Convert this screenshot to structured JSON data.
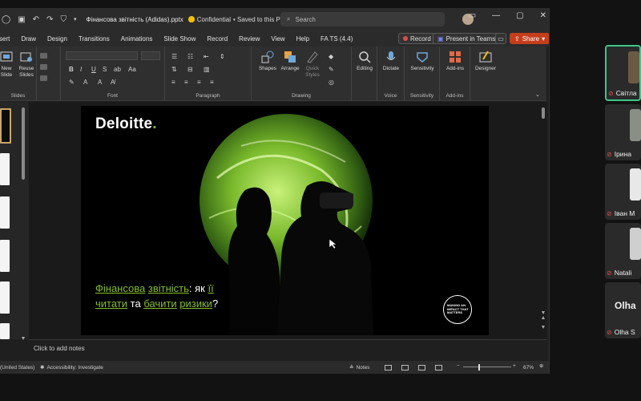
{
  "window": {
    "doc_title": "Фінансова звітність (Adidas).pptx",
    "confidential": "Confidential",
    "saved": "• Saved to this PC",
    "search_placeholder": "Search"
  },
  "tabs": [
    "sert",
    "Draw",
    "Design",
    "Transitions",
    "Animations",
    "Slide Show",
    "Record",
    "Review",
    "View",
    "Help",
    "FA TS (4.4)"
  ],
  "pills": {
    "record": "Record",
    "teams": "Present in Teams",
    "share": "Share"
  },
  "ribbon": {
    "new_slide": "New Slide",
    "reuse_slides": "Reuse Slides",
    "slides_label": "Slides",
    "font_label": "Font",
    "paragraph_label": "Paragraph",
    "shapes": "Shapes",
    "arrange": "Arrange",
    "quick_styles": "Quick Styles",
    "drawing_label": "Drawing",
    "editing": "Editing",
    "dictate": "Dictate",
    "voice_label": "Voice",
    "sensitivity": "Sensitivity",
    "sensitivity_label": "Sensitivity",
    "addins": "Add-ins",
    "addins_label": "Add-ins",
    "designer": "Designer"
  },
  "slide": {
    "logo": "Deloitte",
    "logo_dot": ".",
    "title_line1_a": "Фінансова",
    "title_line1_b": "звітність",
    "title_line1_c": ": як",
    "title_line1_d": "її",
    "title_line2_a": "читати",
    "title_line2_b": "та",
    "title_line2_c": "бачити",
    "title_line2_d": "ризики",
    "title_line2_e": "?",
    "badge": [
      "MAKING AN",
      "IMPACT THAT",
      "MATTERS"
    ]
  },
  "notes_placeholder": "Click to add notes",
  "status": {
    "language": "(United States)",
    "accessibility": "Accessibility: Investigate",
    "notes": "Notes",
    "zoom": "67%"
  },
  "participants": [
    {
      "name": "Світла"
    },
    {
      "name": "Ірина"
    },
    {
      "name": "Іван М"
    },
    {
      "name": "Natali"
    },
    {
      "name": "Olha S",
      "initial": "Olha"
    }
  ],
  "colors": {
    "accent_green": "#86bc25",
    "share": "#c43e1c",
    "active_speaker": "#3fc68a"
  }
}
